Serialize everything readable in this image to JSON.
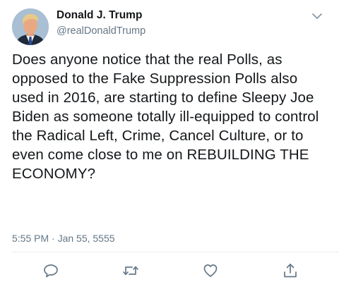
{
  "tweet": {
    "author_name": "Donald J. Trump",
    "author_handle": "@realDonaldTrump",
    "text": "Does anyone notice that the real Polls, as opposed to the Fake Suppression Polls also used in 2016, are starting to define Sleepy Joe Biden as someone totally ill-equipped to control the Radical Left, Crime, Cancel Culture, or to even come close to me on REBUILDING THE ECONOMY?",
    "timestamp": "5:55 PM · Jan 55, 5555"
  },
  "icons": {
    "menu": "chevron-down-icon",
    "reply": "reply-icon",
    "retweet": "retweet-icon",
    "like": "heart-icon",
    "share": "share-icon"
  },
  "colors": {
    "text": "#14171a",
    "secondary": "#657786",
    "divider": "#e6ecf0"
  }
}
